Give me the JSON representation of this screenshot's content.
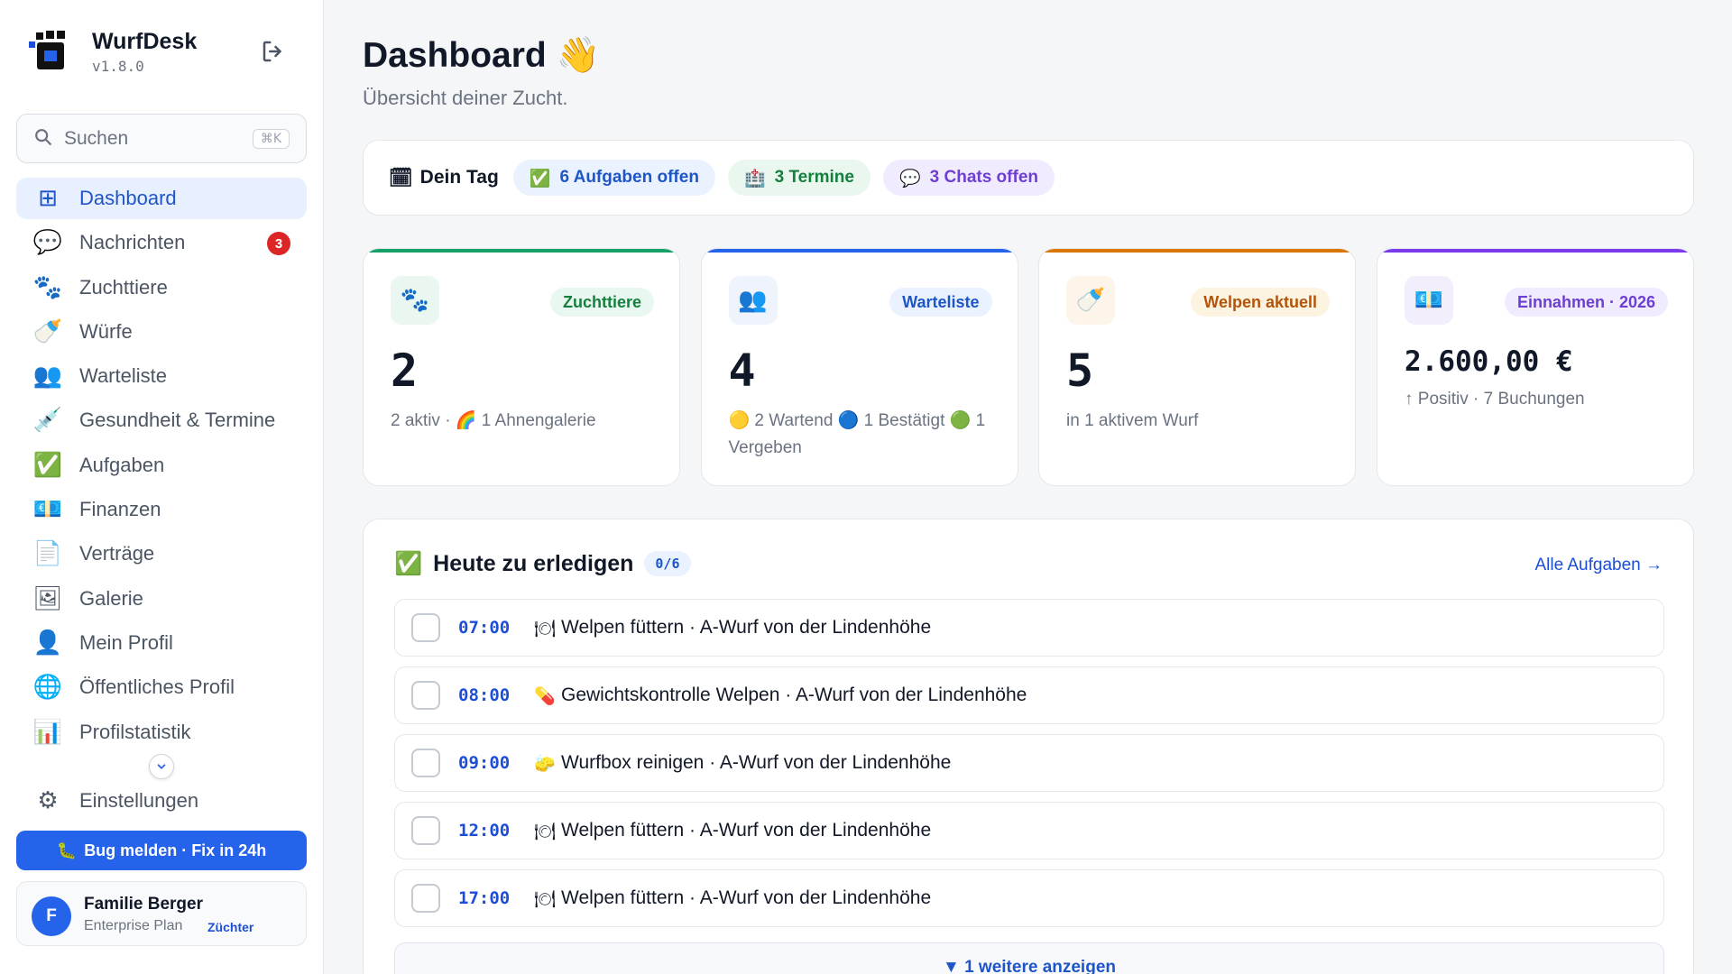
{
  "brand": {
    "name": "WurfDesk",
    "version": "v1.8.0"
  },
  "search": {
    "placeholder": "Suchen",
    "shortcut": "⌘K"
  },
  "nav": {
    "items": [
      {
        "label": "Dashboard",
        "icon": "grid-icon",
        "glyph": "⊞",
        "active": true
      },
      {
        "label": "Nachrichten",
        "icon": "speech-bubble-icon",
        "glyph": "💬",
        "badge": "3"
      },
      {
        "label": "Zuchttiere",
        "icon": "paw-icon",
        "glyph": "🐾"
      },
      {
        "label": "Würfe",
        "icon": "baby-bottle-icon",
        "glyph": "🍼"
      },
      {
        "label": "Warteliste",
        "icon": "people-icon",
        "glyph": "👥"
      },
      {
        "label": "Gesundheit & Termine",
        "icon": "syringe-icon",
        "glyph": "💉"
      },
      {
        "label": "Aufgaben",
        "icon": "check-icon",
        "glyph": "✅"
      },
      {
        "label": "Finanzen",
        "icon": "banknote-icon",
        "glyph": "💶"
      },
      {
        "label": "Verträge",
        "icon": "document-icon",
        "glyph": "📄"
      },
      {
        "label": "Galerie",
        "icon": "picture-icon",
        "glyph": "🖼"
      },
      {
        "label": "Mein Profil",
        "icon": "user-icon",
        "glyph": "👤"
      },
      {
        "label": "Öffentliches Profil",
        "icon": "globe-icon",
        "glyph": "🌐"
      },
      {
        "label": "Profilstatistik",
        "icon": "bar-chart-icon",
        "glyph": "📊"
      }
    ],
    "settings": {
      "label": "Einstellungen",
      "icon": "gear-icon",
      "glyph": "⚙"
    }
  },
  "bug_button": {
    "icon": "bug-icon",
    "glyph": "🐛",
    "label": "Bug melden · Fix in 24h"
  },
  "user": {
    "initial": "F",
    "name": "Familie Berger",
    "plan": "Enterprise Plan",
    "role": "Züchter"
  },
  "header": {
    "title": "Dashboard",
    "title_emoji": "👋",
    "subtitle": "Übersicht deiner Zucht."
  },
  "day": {
    "label": "Dein Tag",
    "label_glyph": "🗓",
    "pills": [
      {
        "glyph": "✅",
        "label": "6 Aufgaben offen",
        "color": "blue"
      },
      {
        "glyph": "🏥",
        "label": "3 Termine",
        "color": "green"
      },
      {
        "glyph": "💬",
        "label": "3 Chats offen",
        "color": "purple"
      }
    ]
  },
  "stats": [
    {
      "tag": "Zuchttiere",
      "glyph": "🐾",
      "value": "2",
      "note": "2 aktiv · 🌈 1 Ahnengalerie",
      "accent": "#16a06a",
      "tag_bg": "#e8f7ef",
      "tag_color": "#15803d",
      "icon_bg": "#eaf7f0"
    },
    {
      "tag": "Warteliste",
      "glyph": "👥",
      "value": "4",
      "note": "🟡 2 Wartend 🔵 1 Bestätigt 🟢 1 Vergeben",
      "accent": "#2563eb",
      "tag_bg": "#eaf2ff",
      "tag_color": "#1e56c8",
      "icon_bg": "#eef3fc"
    },
    {
      "tag": "Welpen aktuell",
      "glyph": "🍼",
      "value": "5",
      "note": "in 1 aktivem Wurf",
      "accent": "#d97706",
      "tag_bg": "#fdf3e1",
      "tag_color": "#b45309",
      "icon_bg": "#fdf5ea"
    },
    {
      "tag": "Einnahmen · 2026",
      "glyph": "💶",
      "value": "2.600,00 €",
      "note": "↑ Positiv · 7 Buchungen",
      "accent": "#7c3aed",
      "tag_bg": "#f1ebff",
      "tag_color": "#6d3fd0",
      "icon_bg": "#f3eefc"
    }
  ],
  "tasks": {
    "title": "Heute zu erledigen",
    "title_glyph": "✅",
    "count": "0/6",
    "all_link": "Alle Aufgaben →",
    "items": [
      {
        "time": "07:00",
        "glyph": "🍽",
        "text": "Welpen füttern · A-Wurf von der Lindenhöhe"
      },
      {
        "time": "08:00",
        "glyph": "💊",
        "text": "Gewichtskontrolle Welpen · A-Wurf von der Lindenhöhe"
      },
      {
        "time": "09:00",
        "glyph": "🧽",
        "text": "Wurfbox reinigen · A-Wurf von der Lindenhöhe"
      },
      {
        "time": "12:00",
        "glyph": "🍽",
        "text": "Welpen füttern · A-Wurf von der Lindenhöhe"
      },
      {
        "time": "17:00",
        "glyph": "🍽",
        "text": "Welpen füttern · A-Wurf von der Lindenhöhe"
      }
    ],
    "more": "▼ 1 weitere anzeigen"
  }
}
